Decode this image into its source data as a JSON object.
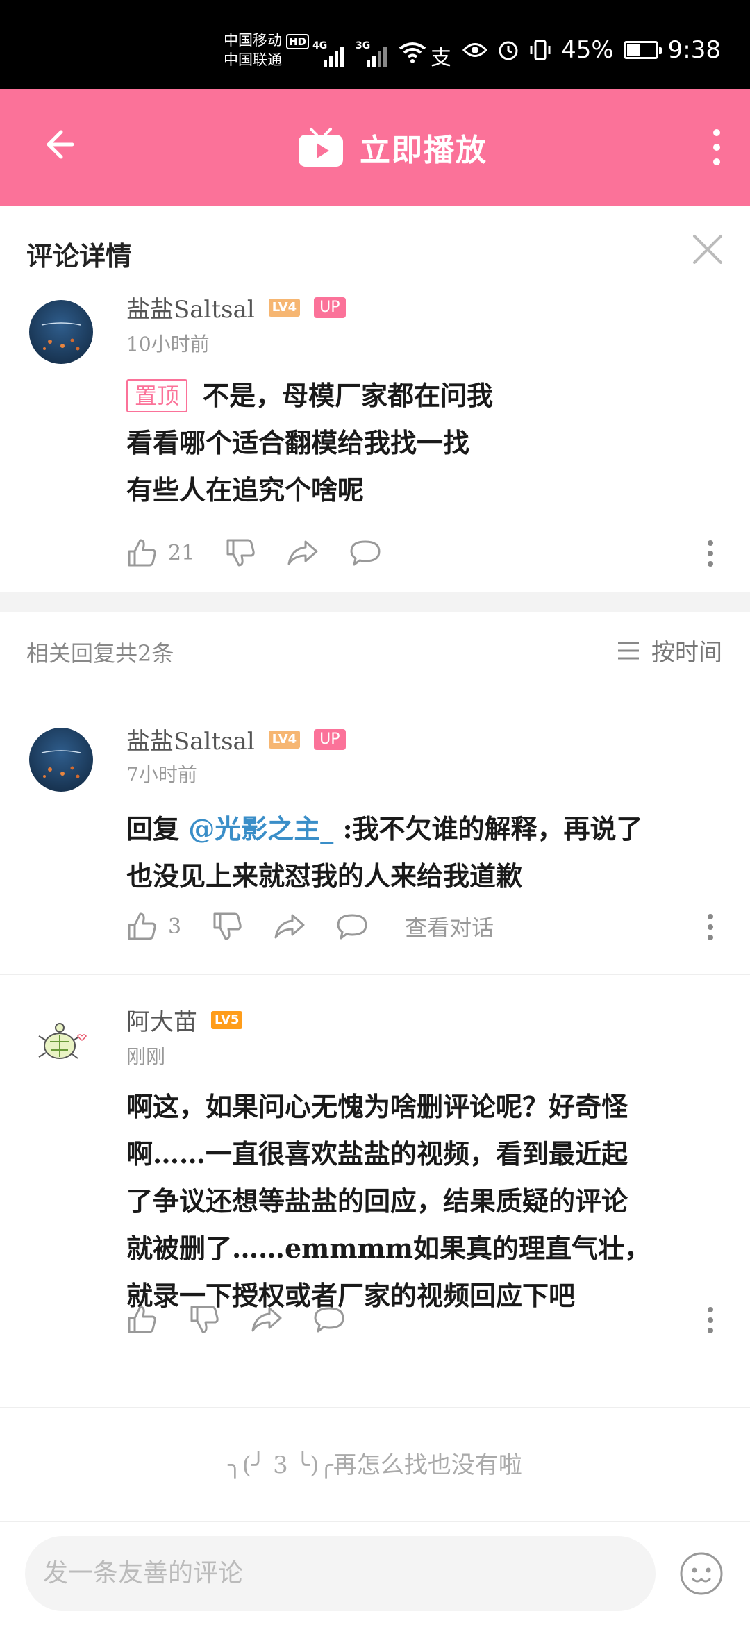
{
  "status_bar": {
    "carrier1": "中国移动",
    "carrier2": "中国联通",
    "hd": "HD",
    "net1": "4G",
    "net2": "3G",
    "battery": "45%",
    "time": "9:38"
  },
  "app_bar": {
    "play_label": "立即播放"
  },
  "detail": {
    "title": "评论详情"
  },
  "main_comment": {
    "username": "盐盐Saltsal",
    "level": "LV4",
    "up_badge": "UP",
    "time": "10小时前",
    "pin_label": "置顶",
    "lines": [
      "不是，母模厂家都在问我",
      "看看哪个适合翻模给我找一找",
      "有些人在追究个啥呢"
    ],
    "likes": "21"
  },
  "replies_header": {
    "count_text": "相关回复共2条",
    "sort_label": "按时间"
  },
  "reply1": {
    "username": "盐盐Saltsal",
    "level": "LV4",
    "up_badge": "UP",
    "time": "7小时前",
    "prefix": "回复 ",
    "mention": "@光影之主_",
    "text1": " :我不欠谁的解释，再说了",
    "text2": "也没见上来就怼我的人来给我道歉",
    "likes": "3",
    "view_convo": "查看对话"
  },
  "reply2": {
    "username": "阿大苗",
    "level": "LV5",
    "time": "刚刚",
    "lines": [
      "啊这，如果问心无愧为啥删评论呢？好奇怪",
      "啊……一直很喜欢盐盐的视频，看到最近起",
      "了争议还想等盐盐的回应，结果质疑的评论",
      "就被删了……emmmm如果真的理直气壮，",
      "就录一下授权或者厂家的视频回应下吧"
    ]
  },
  "end_tip": "╮(╯ 3 ╰)╭再怎么找也没有啦",
  "bottom_bar": {
    "input_placeholder": "发一条友善的评论"
  },
  "colors": {
    "brand_pink": "#fb7299",
    "mention_blue": "#3a8ec8"
  }
}
